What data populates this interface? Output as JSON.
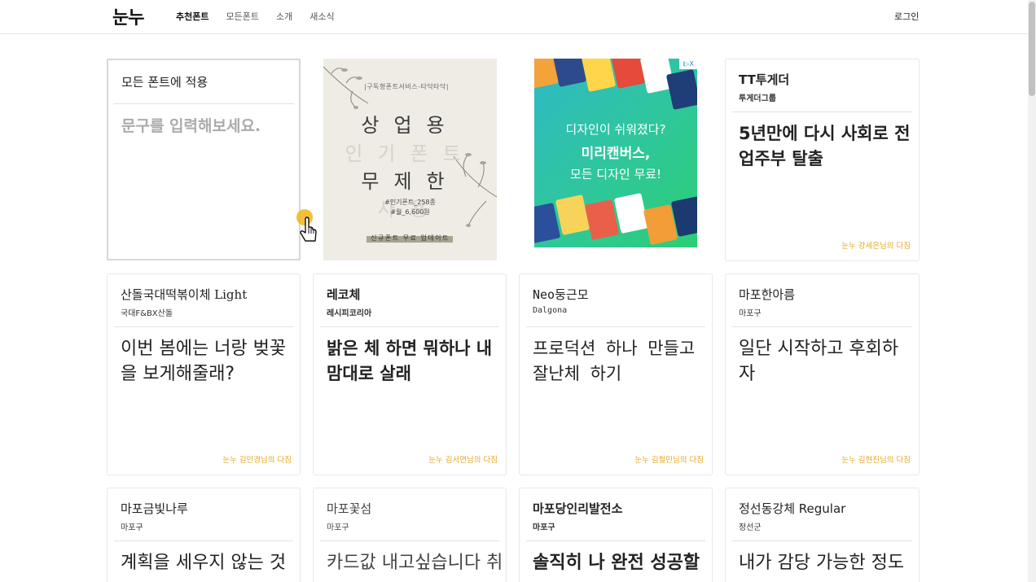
{
  "nav": {
    "logo": "눈누",
    "items": [
      "추천폰트",
      "모든폰트",
      "소개",
      "새소식"
    ],
    "login": "로그인"
  },
  "apply_all": {
    "title": "모든 폰트에 적용",
    "placeholder": "문구를 입력해보세요."
  },
  "ad_left": {
    "tag": "|구독형폰트서비스-타닥타닥|",
    "line1": "상업용",
    "line2": "인기폰트",
    "line3": "무제한",
    "line4": "사용",
    "detail1": "#인기폰트_258종",
    "detail2": "#월_6,600원",
    "bottom": "신규폰트 무료 업데이트"
  },
  "ad_right": {
    "badge": "i▷X",
    "line1": "디자인이 쉬워졌다?",
    "line2": "미리캔버스,",
    "line3": "모든 디자인 무료!"
  },
  "cards": [
    {
      "name": "TT투게더",
      "maker": "투게더그룹",
      "sample": "5년만에 다시 사회로 전업주부 탈출",
      "credit": "눈누 강세은님의 다짐"
    },
    {
      "name": "산돌국대떡볶이체 Light",
      "maker": "국대F&BX산돌",
      "sample": "이번 봄에는 너랑 벚꽃을 보게해줄래?",
      "credit": "눈누 김민경님의 다짐"
    },
    {
      "name": "레코체",
      "maker": "레시피코리아",
      "sample": "밝은 체 하면 뭐하나 내 맘대로 살래",
      "credit": "눈누 김서연님의 다짐"
    },
    {
      "name": "Neo둥근모",
      "maker": "Dalgona",
      "sample": "프로덕션 하나 만들고 잘난체 하기",
      "credit": "눈누 김철민님의 다짐"
    },
    {
      "name": "마포한아름",
      "maker": "마포구",
      "sample": "일단 시작하고 후회하자",
      "credit": "눈누 김현진님의 다짐"
    },
    {
      "name": "마포금빛나루",
      "maker": "마포구",
      "sample": "계획을 세우지 않는 것",
      "credit": ""
    },
    {
      "name": "마포꽃섬",
      "maker": "마포구",
      "sample": "카드값 내고싶습니다 취",
      "credit": ""
    },
    {
      "name": "마포당인리발전소",
      "maker": "마포구",
      "sample": "솔직히 나 완전 성공할",
      "credit": ""
    },
    {
      "name": "정선동강체 Regular",
      "maker": "정선군",
      "sample": "내가 감당 가능한 정도",
      "credit": ""
    }
  ]
}
